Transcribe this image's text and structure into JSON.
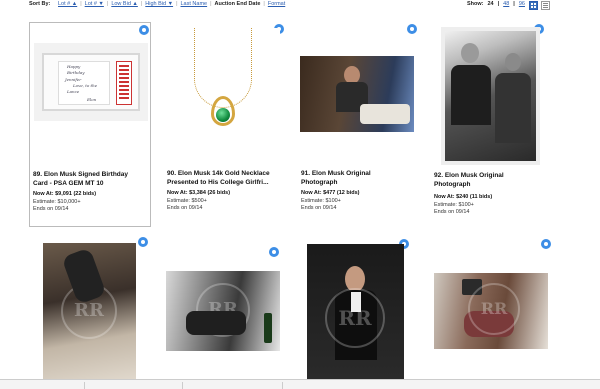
{
  "sort": {
    "label": "Sort By:",
    "options": [
      {
        "label": "Lot # ▲"
      },
      {
        "label": "Lot # ▼"
      },
      {
        "label": "Low Bid ▲"
      },
      {
        "label": "High Bid ▼"
      },
      {
        "label": "Last Name"
      },
      {
        "label": "Auction End Date"
      },
      {
        "label": "Format"
      }
    ]
  },
  "show": {
    "label": "Show:",
    "options": [
      "24",
      "48",
      "96"
    ]
  },
  "items": [
    {
      "title_line1": "89. Elon Musk Signed Birthday",
      "title_line2": "Card - PSA GEM MT 10",
      "now_at": "Now At: $9,091 (22 bids)",
      "estimate": "Estimate: $10,000+",
      "ends": "Ends on 09/14",
      "card_text": [
        "Happy",
        "Birthday",
        "Jennifer",
        "Love, to the",
        "Lance",
        "Elon"
      ]
    },
    {
      "title_line1": "90. Elon Musk 14k Gold Necklace",
      "title_line2": "Presented to His College Girlfri...",
      "now_at": "Now At: $3,384 (26 bids)",
      "estimate": "Estimate: $500+",
      "ends": "Ends on 09/14"
    },
    {
      "title_line1": "91. Elon Musk Original",
      "title_line2": "Photograph",
      "now_at": "Now At: $477 (12 bids)",
      "estimate": "Estimate: $100+",
      "ends": "Ends on 09/14"
    },
    {
      "title_line1": "92. Elon Musk Original",
      "title_line2": "Photograph",
      "now_at": "Now At: $240 (11 bids)",
      "estimate": "Estimate: $100+",
      "ends": "Ends on 09/14"
    }
  ],
  "watermark": "RR"
}
